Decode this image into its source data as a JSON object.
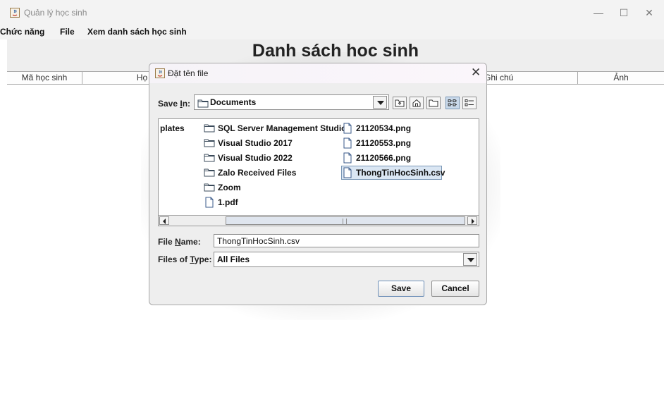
{
  "window": {
    "title": "Quản lý học sinh",
    "minimize": "—",
    "maximize": "☐",
    "close": "✕"
  },
  "menu": {
    "items": [
      "Chức năng",
      "File",
      "Xem danh sách học sinh"
    ]
  },
  "main": {
    "heading": "Danh sách hoc sinh",
    "columns": [
      "Mã học sinh",
      "Họ tên",
      "",
      "",
      "",
      "Ghi chú",
      "Ảnh"
    ]
  },
  "dialog": {
    "title": "Đặt tên file",
    "close": "✕",
    "save_in": {
      "label_pre": "Save ",
      "label_key": "I",
      "label_post": "n:",
      "value": "Documents"
    },
    "files": {
      "col1": [
        "plates"
      ],
      "col2": [
        {
          "name": "SQL Server Management Studio",
          "icon": "folder-icon"
        },
        {
          "name": "Visual Studio 2017",
          "icon": "folder-icon"
        },
        {
          "name": "Visual Studio 2022",
          "icon": "folder-icon"
        },
        {
          "name": "Zalo Received Files",
          "icon": "folder-icon"
        },
        {
          "name": "Zoom",
          "icon": "folder-icon"
        },
        {
          "name": "1.pdf",
          "icon": "file-icon"
        }
      ],
      "col3": [
        {
          "name": "21120534.png",
          "icon": "file-icon"
        },
        {
          "name": "21120553.png",
          "icon": "file-icon"
        },
        {
          "name": "21120566.png",
          "icon": "file-icon"
        },
        {
          "name": "ThongTinHocSinh.csv",
          "icon": "file-icon",
          "selected": true
        }
      ]
    },
    "file_name": {
      "label_pre": "File ",
      "label_key": "N",
      "label_post": "ame:",
      "value": "ThongTinHocSinh.csv"
    },
    "file_type": {
      "label_pre": "Files of ",
      "label_key": "T",
      "label_post": "ype:",
      "value": "All Files"
    },
    "buttons": {
      "save": "Save",
      "cancel": "Cancel"
    }
  }
}
